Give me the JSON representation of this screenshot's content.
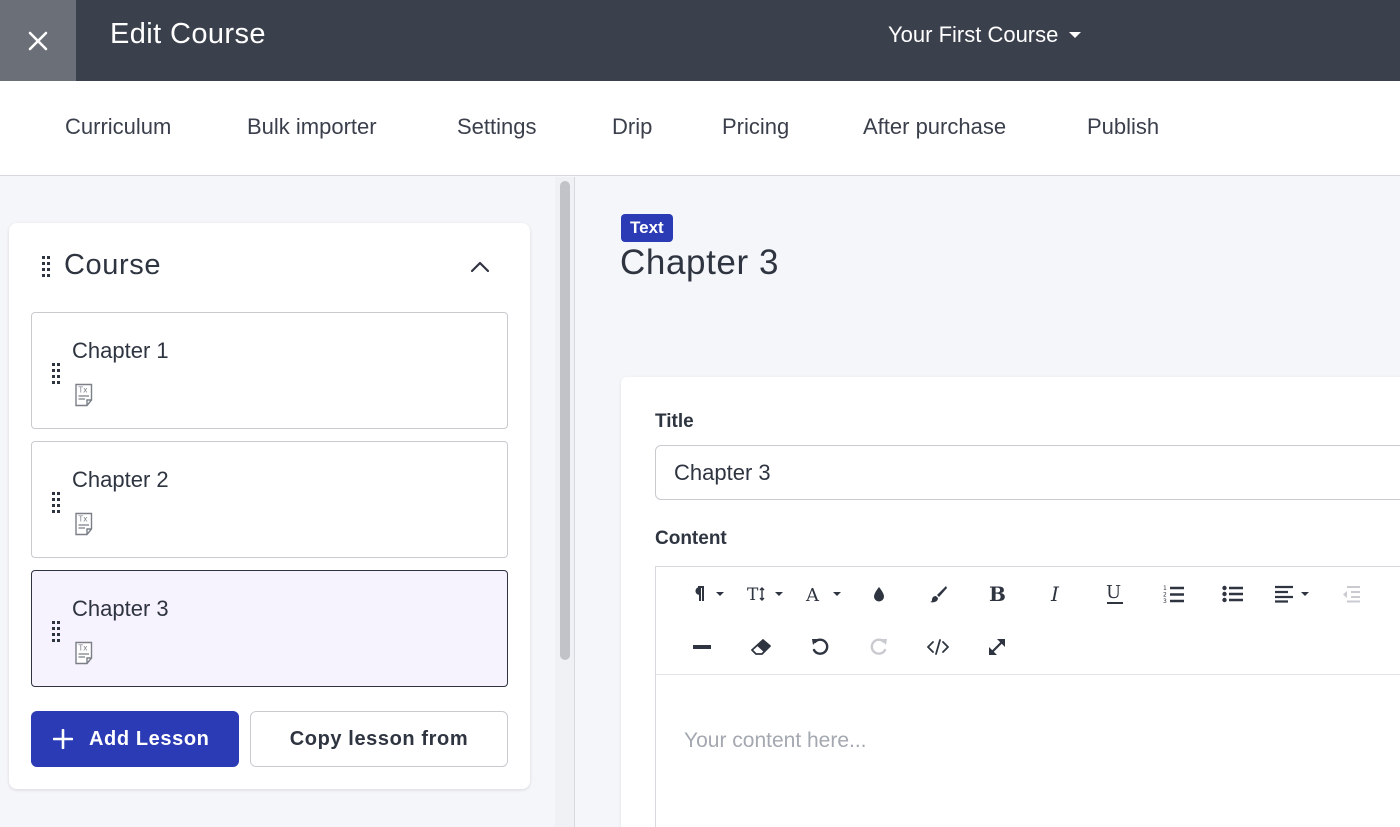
{
  "header": {
    "close_icon": "close-icon",
    "title": "Edit Course",
    "course_selector": "Your First Course",
    "course_selector_icon": "caret-down-icon"
  },
  "tabs": [
    {
      "label": "Curriculum"
    },
    {
      "label": "Bulk importer"
    },
    {
      "label": "Settings"
    },
    {
      "label": "Drip"
    },
    {
      "label": "Pricing"
    },
    {
      "label": "After purchase"
    },
    {
      "label": "Publish"
    }
  ],
  "sidebar": {
    "section_title": "Course",
    "collapse_icon": "chevron-up-icon",
    "lessons": [
      {
        "name": "Chapter 1",
        "icon": "text-lesson-icon"
      },
      {
        "name": "Chapter 2",
        "icon": "text-lesson-icon"
      },
      {
        "name": "Chapter 3",
        "icon": "text-lesson-icon",
        "selected": true
      }
    ],
    "add_lesson_label": "Add Lesson",
    "copy_lesson_label": "Copy lesson from"
  },
  "editor": {
    "type_badge": "Text",
    "heading": "Chapter 3",
    "title_label": "Title",
    "title_value": "Chapter 3",
    "content_label": "Content",
    "content_placeholder": "Your content here...",
    "toolbar": [
      "paragraph-format-icon",
      "font-size-icon",
      "font-family-icon",
      "text-color-icon",
      "brush-icon",
      "bold-icon",
      "italic-icon",
      "underline-icon",
      "ordered-list-icon",
      "unordered-list-icon",
      "align-icon",
      "outdent-icon",
      "horizontal-line-icon",
      "clear-formatting-icon",
      "undo-icon",
      "redo-icon",
      "code-view-icon",
      "fullscreen-icon"
    ]
  },
  "colors": {
    "topbar": "#3b404d",
    "close_button": "#6b6f78",
    "accent": "#2a3bb5",
    "selected_lesson_bg": "#f6f2fe"
  }
}
